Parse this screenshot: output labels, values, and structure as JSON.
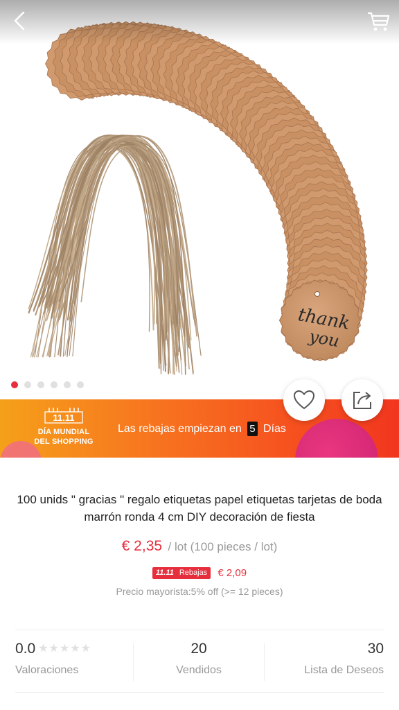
{
  "nav": {
    "back_icon": "chevron-left-icon",
    "cart_icon": "cart-icon"
  },
  "gallery": {
    "image_subject": "kraft paper scalloped gift tags with jute twine",
    "tag_handwriting_line1": "thank",
    "tag_handwriting_line2": "you",
    "dots_count": 6,
    "active_dot": 0
  },
  "banner": {
    "logo_text": "11.11",
    "logo_line1": "DÍA MUNDIAL",
    "logo_line2": "DEL SHOPPING",
    "text_before": "Las rebajas empiezan en",
    "days": "5",
    "text_after": "Días"
  },
  "actions": {
    "wishlist_icon": "heart-icon",
    "share_icon": "share-icon"
  },
  "product": {
    "title": "100 unids \" gracias \" regalo etiquetas papel etiquetas tarjetas de boda marrón ronda 4 cm DIY decoración de fiesta",
    "price": "€ 2,35",
    "price_unit": "/ lot (100 pieces / lot)",
    "promo_logo": "11.11",
    "promo_label": "Rebajas",
    "promo_price": "€ 2,09",
    "wholesale": "Precio mayorista:5% off (>= 12 pieces)"
  },
  "stats": {
    "rating_value": "0.0",
    "rating_stars": "★★★★★",
    "rating_label": "Valoraciones",
    "sold_value": "20",
    "sold_label": "Vendidos",
    "wishlist_value": "30",
    "wishlist_label": "Lista de Deseos"
  },
  "colors": {
    "accent_red": "#e62e3c",
    "banner_orange": "#f7781f",
    "kraft": "#c9956a"
  }
}
